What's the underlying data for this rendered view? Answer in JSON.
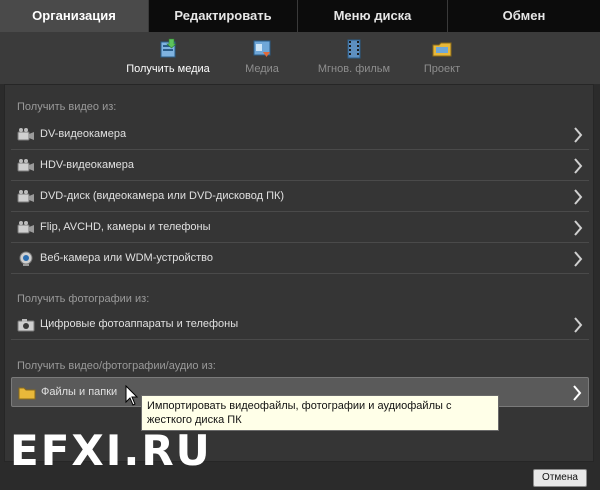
{
  "tabs": [
    {
      "label": "Организация"
    },
    {
      "label": "Редактировать"
    },
    {
      "label": "Меню диска"
    },
    {
      "label": "Обмен"
    }
  ],
  "subtabs": [
    {
      "label": "Получить медиа",
      "icon": "get-media-icon"
    },
    {
      "label": "Медиа",
      "icon": "media-icon"
    },
    {
      "label": "Мгнов. фильм",
      "icon": "instant-movie-icon"
    },
    {
      "label": "Проект",
      "icon": "project-icon"
    }
  ],
  "sections": [
    {
      "title": "Получить видео из:",
      "items": [
        {
          "label": "DV-видеокамера",
          "icon": "camcorder-icon"
        },
        {
          "label": "HDV-видеокамера",
          "icon": "camcorder-icon"
        },
        {
          "label": "DVD-диск (видеокамера или DVD-дисковод ПК)",
          "icon": "camcorder-icon"
        },
        {
          "label": "Flip, AVCHD, камеры и телефоны",
          "icon": "camcorder-icon"
        },
        {
          "label": "Веб-камера или WDM-устройство",
          "icon": "webcam-icon"
        }
      ]
    },
    {
      "title": "Получить фотографии из:",
      "items": [
        {
          "label": "Цифровые фотоаппараты и телефоны",
          "icon": "camera-icon"
        }
      ]
    },
    {
      "title": "Получить видео/фотографии/аудио из:",
      "items": [
        {
          "label": "Файлы и папки",
          "icon": "folder-icon"
        }
      ]
    }
  ],
  "tooltip": "Импортировать видеофайлы, фотографии и аудиофайлы с жесткого диска ПК",
  "watermark": "EFXI.RU",
  "cancel_label": "Отмена",
  "colors": {
    "background": "#2b2b2b",
    "tab_bar": "#0c0c0c",
    "active_tab": "#4a4a4a",
    "tooltip_bg": "#ffffe8"
  }
}
